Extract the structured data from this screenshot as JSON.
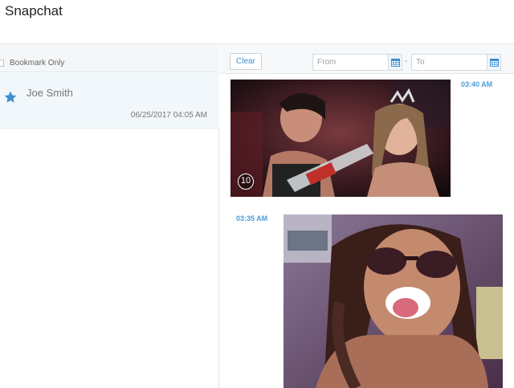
{
  "app": {
    "title": "Snapchat"
  },
  "filter": {
    "bookmark_only_label": "Bookmark Only",
    "bookmark_only_checked": false
  },
  "contacts": [
    {
      "name": "Joe Smith",
      "timestamp": "06/25/2017 04:05 AM",
      "starred": true,
      "selected": true
    }
  ],
  "toolbar": {
    "clear_label": "Clear",
    "from_placeholder": "From",
    "to_placeholder": "To",
    "separator": "-"
  },
  "messages": [
    {
      "time": "03:40 AM",
      "type": "image",
      "timer_badge": "10",
      "direction": "incoming"
    },
    {
      "time": "03:35 AM",
      "type": "image",
      "direction": "outgoing"
    }
  ],
  "colors": {
    "accent": "#4b9bd8",
    "star": "#3a8fd3",
    "selected_row": "#f2f7fb"
  },
  "icons": {
    "bookmark": "star-icon",
    "calendar": "calendar-icon",
    "timer": "timer-badge-icon"
  }
}
